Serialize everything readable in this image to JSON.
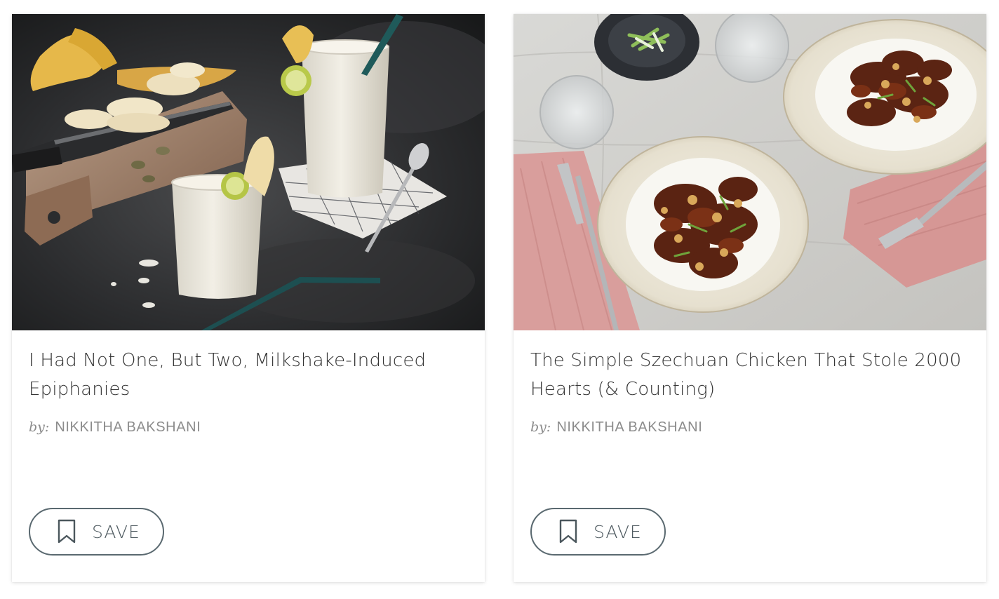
{
  "cards": [
    {
      "title": "I Had Not One, But Two, Milkshake-Induced Epiphanies",
      "byline_prefix": "by:",
      "author": "NIKKITHA BAKSHANI",
      "save_label": "SAVE",
      "image_alt": "Two banana milkshakes with teal straws beside a cutting board with sliced bananas and a knife"
    },
    {
      "title": "The Simple Szechuan Chicken That Stole 2000 Hearts (& Counting)",
      "byline_prefix": "by:",
      "author": "NIKKITHA BAKSHANI",
      "save_label": "SAVE",
      "image_alt": "Two bowls of Szechuan chicken over rice on a linen tablecloth with pink napkins and forks"
    }
  ],
  "icons": {
    "save": "bookmark-icon"
  },
  "colors": {
    "button_border": "#5a6970",
    "title_text": "#333333",
    "byline_text": "#8c8c8c"
  }
}
